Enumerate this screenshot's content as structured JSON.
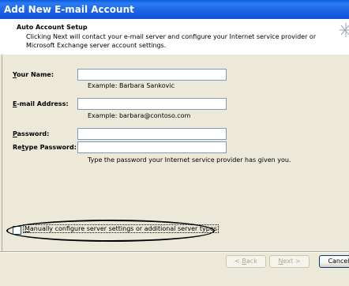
{
  "window": {
    "title": "Add New E-mail Account"
  },
  "header": {
    "title": "Auto Account Setup",
    "description": "Clicking Next will contact your e-mail server and configure your Internet service provider or Microsoft Exchange server account settings."
  },
  "form": {
    "name": {
      "label_u": "Y",
      "label_rest": "our Name:",
      "value": "",
      "example": "Example: Barbara Sankovic"
    },
    "email": {
      "label_u": "E",
      "label_rest": "-mail Address:",
      "value": "",
      "example": "Example: barbara@contoso.com"
    },
    "password": {
      "label_u": "P",
      "label_rest": "assword:",
      "value": ""
    },
    "retype": {
      "label_pre": "Re",
      "label_u": "t",
      "label_rest": "ype Password:",
      "value": ""
    },
    "hint": "Type the password your Internet service provider has given you."
  },
  "manual": {
    "label_u": "M",
    "label_rest": "anually configure server settings or additional server types",
    "checked": false
  },
  "buttons": {
    "back_pre": "< ",
    "back_u": "B",
    "back_rest": "ack",
    "next_u": "N",
    "next_rest": "ext >",
    "cancel": "Cancel"
  }
}
